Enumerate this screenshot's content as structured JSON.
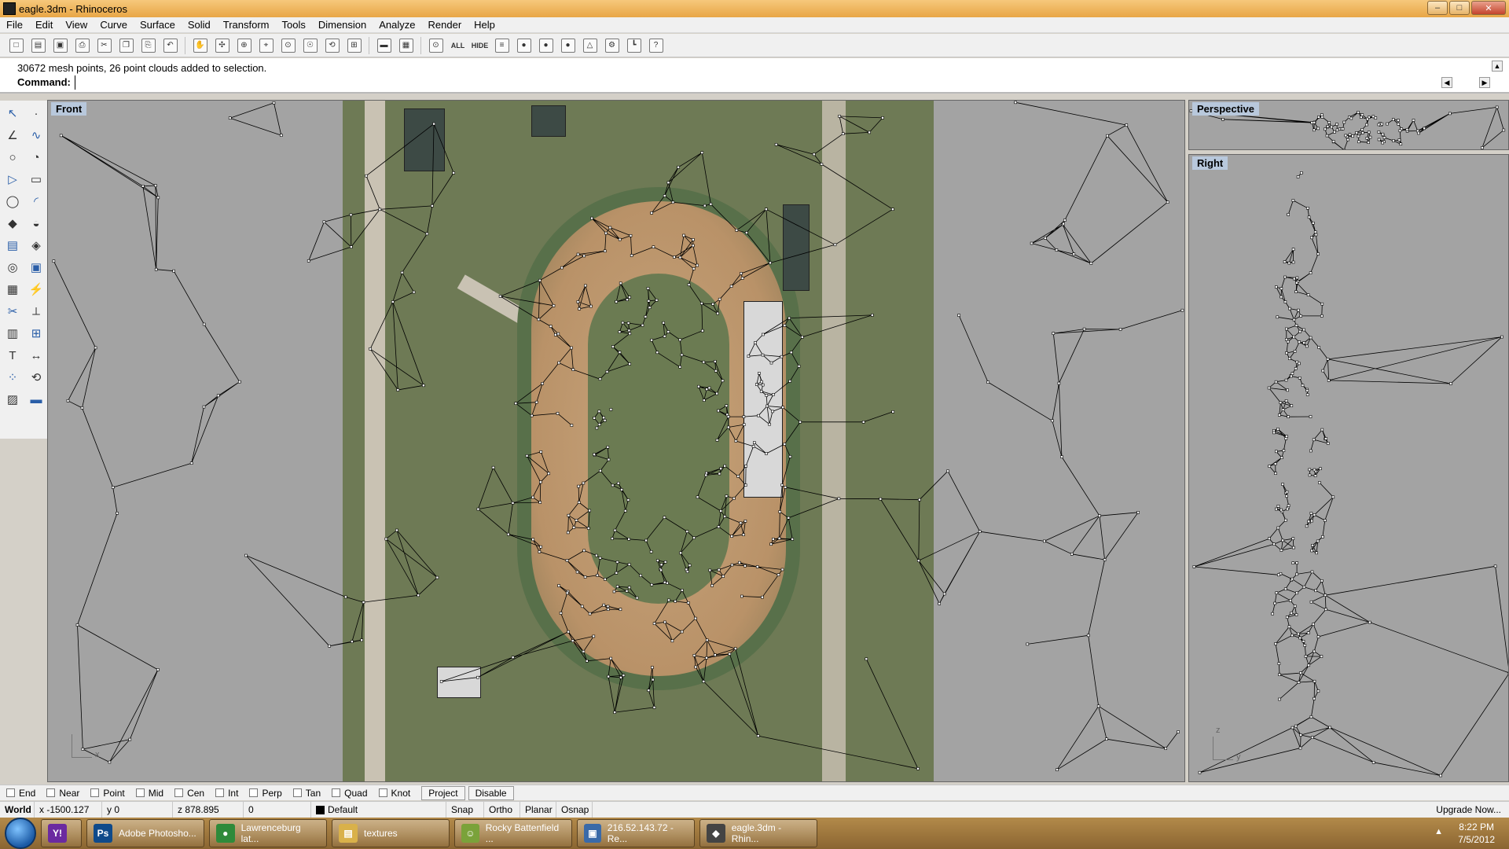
{
  "window": {
    "title": "eagle.3dm - Rhinoceros",
    "min": "–",
    "max": "□",
    "close": "✕"
  },
  "menu": [
    "File",
    "Edit",
    "View",
    "Curve",
    "Surface",
    "Solid",
    "Transform",
    "Tools",
    "Dimension",
    "Analyze",
    "Render",
    "Help"
  ],
  "toolbar": {
    "items": [
      {
        "name": "new-icon",
        "glyph": "□"
      },
      {
        "name": "open-icon",
        "glyph": "▤"
      },
      {
        "name": "save-icon",
        "glyph": "▣"
      },
      {
        "name": "print-icon",
        "glyph": "⎙"
      },
      {
        "name": "cut-icon",
        "glyph": "✂"
      },
      {
        "name": "copy-icon",
        "glyph": "❐"
      },
      {
        "name": "paste-icon",
        "glyph": "⎘"
      },
      {
        "name": "undo-icon",
        "glyph": "↶"
      },
      {
        "name": "pan-icon",
        "glyph": "✋"
      },
      {
        "name": "rotate-view-icon",
        "glyph": "✣"
      },
      {
        "name": "zoom-dynamic-icon",
        "glyph": "⊕"
      },
      {
        "name": "zoom-window-icon",
        "glyph": "⌖"
      },
      {
        "name": "zoom-extents-icon",
        "glyph": "⊙"
      },
      {
        "name": "zoom-selected-icon",
        "glyph": "☉"
      },
      {
        "name": "undo-view-icon",
        "glyph": "⟲"
      },
      {
        "name": "four-viewports-icon",
        "glyph": "⊞"
      },
      {
        "name": "car-icon",
        "glyph": "▬"
      },
      {
        "name": "grid-object-icon",
        "glyph": "▦"
      },
      {
        "name": "select-icon",
        "glyph": "⊙"
      },
      {
        "name": "show-all-icon",
        "glyph": "ALL",
        "text": true
      },
      {
        "name": "hide-icon",
        "glyph": "HIDE",
        "text": true
      },
      {
        "name": "layers-icon",
        "glyph": "≡"
      },
      {
        "name": "color-wheel-icon",
        "glyph": "●"
      },
      {
        "name": "render-sphere-icon",
        "glyph": "●"
      },
      {
        "name": "shaded-sphere-icon",
        "glyph": "●"
      },
      {
        "name": "properties-icon",
        "glyph": "△"
      },
      {
        "name": "options-gear-icon",
        "glyph": "⚙"
      },
      {
        "name": "dimension-icon",
        "glyph": "┗"
      },
      {
        "name": "help-icon",
        "glyph": "?"
      }
    ]
  },
  "command": {
    "history": "30672 mesh points, 26 point clouds added to selection.",
    "label": "Command:",
    "value": ""
  },
  "palette": [
    "select-arrow-icon",
    "point-icon",
    "polyline-icon",
    "curve-icon",
    "circle-icon",
    "arc-icon",
    "polygon-icon",
    "rectangle-icon",
    "ellipse-icon",
    "fillet-icon",
    "surface-icon",
    "patch-icon",
    "box-icon",
    "boolean-icon",
    "cylinder-icon",
    "extrude-icon",
    "mesh-icon",
    "edit-points-icon",
    "trim-icon",
    "split-icon",
    "group-icon",
    "block-icon",
    "text-icon",
    "dimension-icon",
    "array-icon",
    "orient-icon",
    "analyze-icon",
    "render-icon"
  ],
  "paletteColors": {
    "primary": "#2a5ea8",
    "accent": "#e2b23a"
  },
  "viewports": {
    "front": {
      "label": "Front",
      "axis_x": "x",
      "axis_y": ""
    },
    "perspective": {
      "label": "Perspective"
    },
    "right": {
      "label": "Right",
      "axis_z": "z",
      "axis_y": "y"
    }
  },
  "osnap": {
    "items": [
      "End",
      "Near",
      "Point",
      "Mid",
      "Cen",
      "Int",
      "Perp",
      "Tan",
      "Quad",
      "Knot"
    ],
    "project": "Project",
    "disable": "Disable"
  },
  "status": {
    "cplane": "World",
    "x": "x -1500.127",
    "y": "y 0",
    "z": "z 878.895",
    "extra": "0",
    "layer": "Default",
    "snap": "Snap",
    "ortho": "Ortho",
    "planar": "Planar",
    "osnap": "Osnap",
    "upgrade": "Upgrade Now..."
  },
  "taskbar": {
    "tasks": [
      {
        "name": "task-yahoo",
        "label": "",
        "icon": "Y!",
        "color": "#6b2aa0"
      },
      {
        "name": "task-photoshop",
        "label": "Adobe Photosho...",
        "icon": "Ps",
        "color": "#0f4a8a"
      },
      {
        "name": "task-chrome",
        "label": "Lawrenceburg lat...",
        "icon": "●",
        "color": "#2f8a3a"
      },
      {
        "name": "task-explorer",
        "label": "textures",
        "icon": "▤",
        "color": "#d9b14a"
      },
      {
        "name": "task-chat",
        "label": "Rocky Battenfield ...",
        "icon": "☺",
        "color": "#7aa23a"
      },
      {
        "name": "task-remote",
        "label": "216.52.143.72 - Re...",
        "icon": "▣",
        "color": "#3a6aa8"
      },
      {
        "name": "task-rhino",
        "label": "eagle.3dm - Rhin...",
        "icon": "◆",
        "color": "#444"
      }
    ],
    "time": "8:22 PM",
    "date": "7/5/2012"
  }
}
